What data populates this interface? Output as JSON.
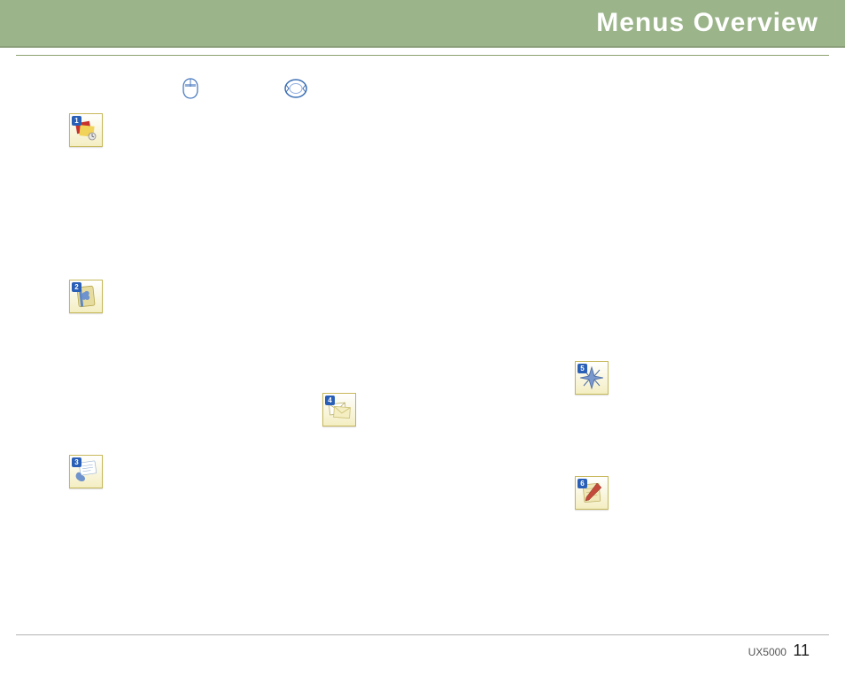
{
  "header": {
    "title": "Menus Overview"
  },
  "icons": {
    "mouse": "mouse-icon",
    "ring": "nav-ring-icon",
    "menu1": {
      "badge": "1",
      "name": "messaging-icon"
    },
    "menu2": {
      "badge": "2",
      "name": "contacts-icon"
    },
    "menu3": {
      "badge": "3",
      "name": "recent-calls-icon"
    },
    "menu4": {
      "badge": "4",
      "name": "mail-icon"
    },
    "menu5": {
      "badge": "5",
      "name": "axcess-icon"
    },
    "menu6": {
      "badge": "6",
      "name": "my-media-icon"
    }
  },
  "footer": {
    "model": "UX5000",
    "page": "11"
  }
}
